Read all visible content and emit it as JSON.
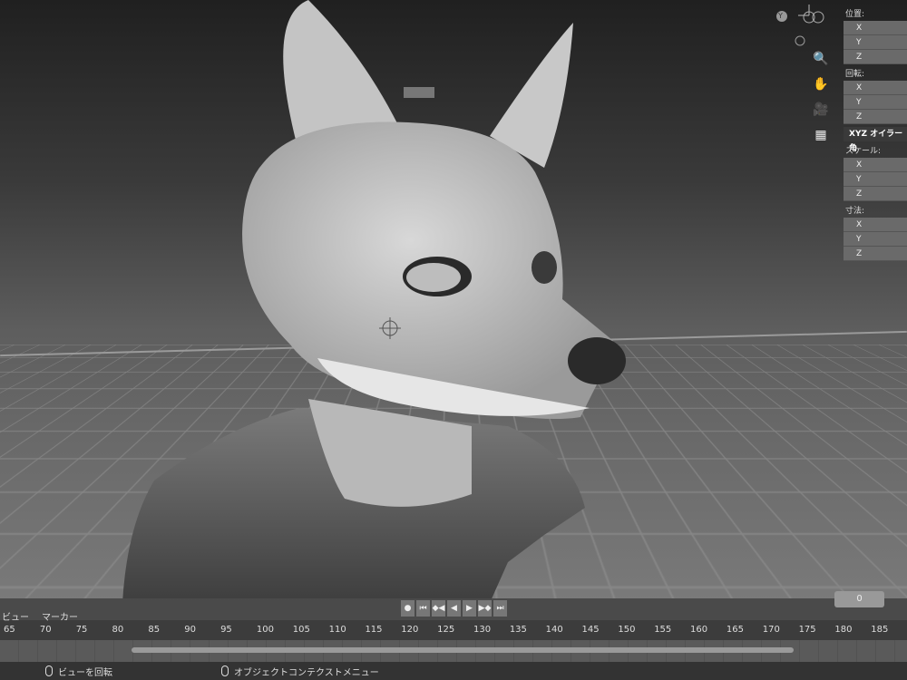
{
  "n_panel": {
    "location_label": "位置:",
    "rotation_label": "回転:",
    "rotation_mode": "XYZ オイラー角",
    "scale_label": "スケール:",
    "dimensions_label": "寸法:",
    "axes": [
      "X",
      "Y",
      "Z"
    ]
  },
  "gizmo": {
    "axis_label": "Y"
  },
  "tools": {
    "zoom": "🔍",
    "pan": "✋",
    "camera": "🎥",
    "grid": "▦"
  },
  "timeline": {
    "menu": [
      "ビュー",
      "マーカー"
    ],
    "current_frame": "0",
    "frames": [
      "65",
      "70",
      "75",
      "80",
      "85",
      "90",
      "95",
      "100",
      "105",
      "110",
      "115",
      "120",
      "125",
      "130",
      "135",
      "140",
      "145",
      "150",
      "155",
      "160",
      "165",
      "170",
      "175",
      "180",
      "185"
    ],
    "controls": [
      "●",
      "⏮",
      "◆◀",
      "◀",
      "▶",
      "▶◆",
      "⏭"
    ]
  },
  "status_bar": {
    "rotate_view": "ビューを回転",
    "context_menu": "オブジェクトコンテクストメニュー"
  }
}
